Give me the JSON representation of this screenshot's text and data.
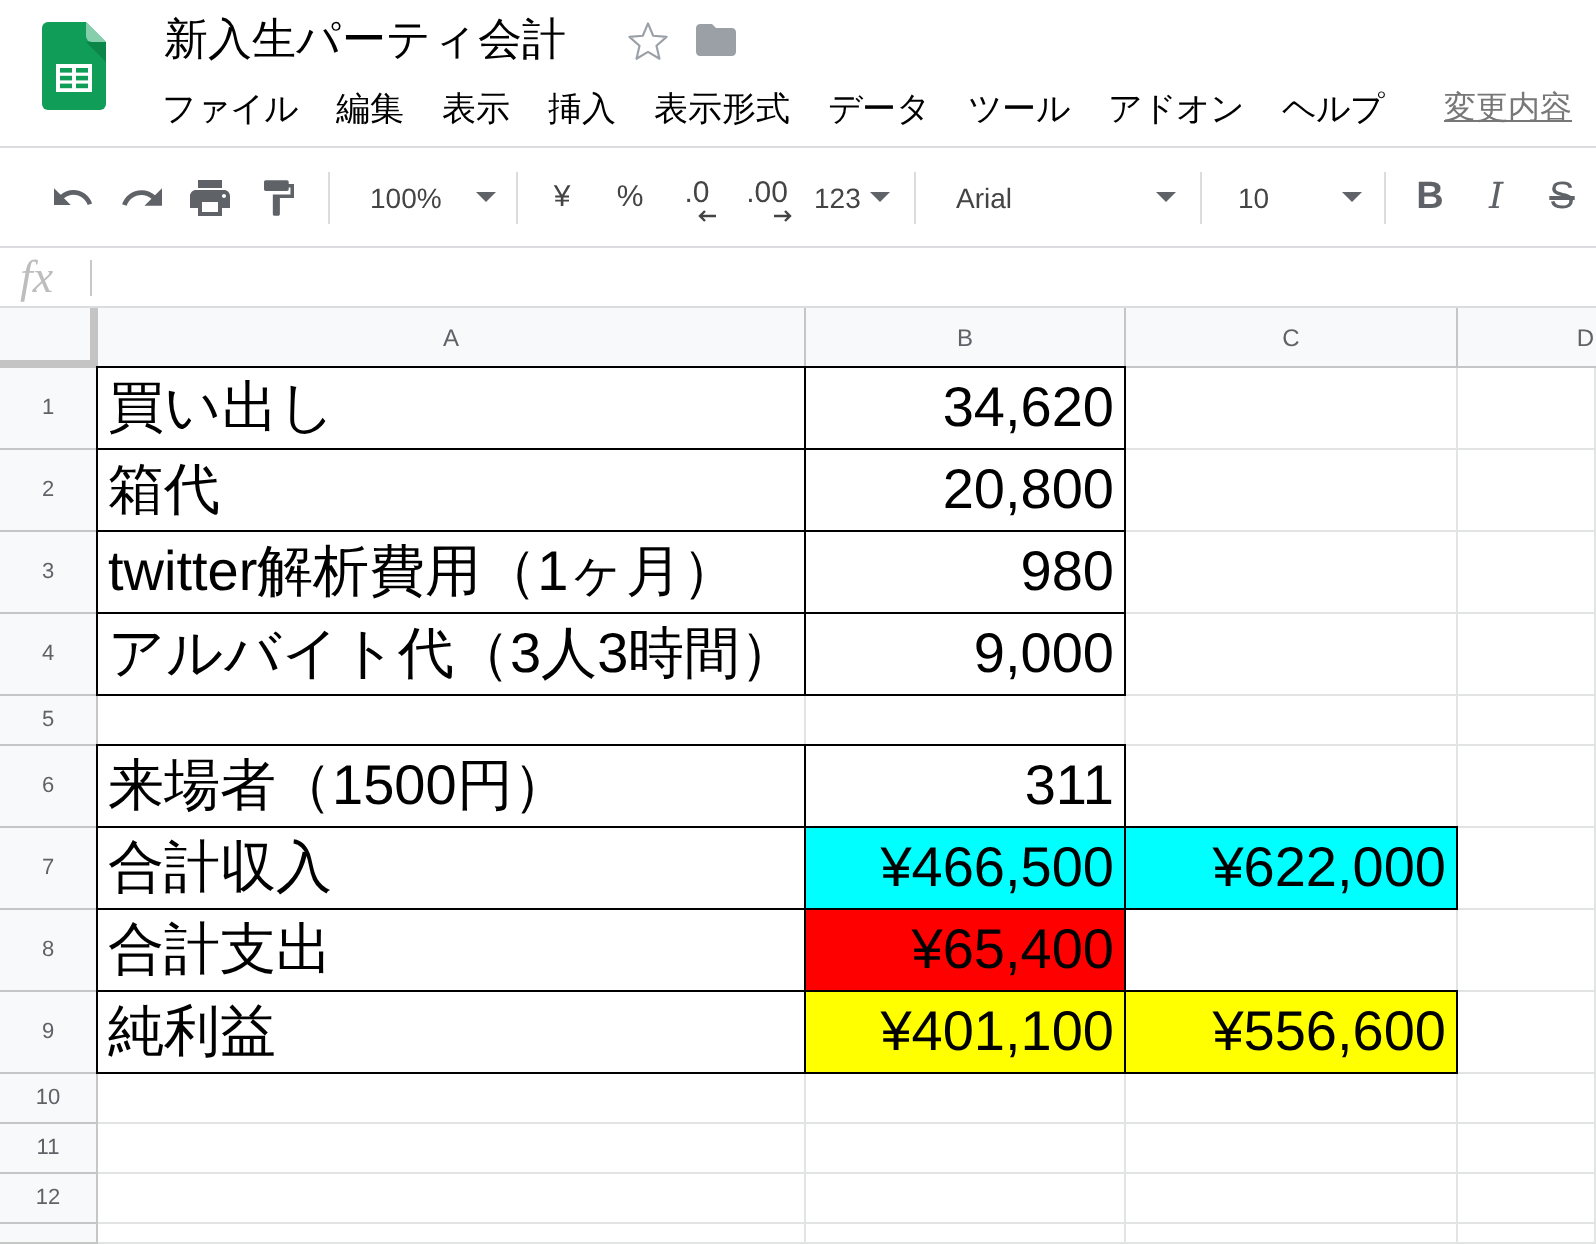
{
  "app": {
    "title": "新入生パーティ会計",
    "starred": false
  },
  "menu": [
    "ファイル",
    "編集",
    "表示",
    "挿入",
    "表示形式",
    "データ",
    "ツール",
    "アドオン",
    "ヘルプ"
  ],
  "save_status": "変更内容",
  "toolbar": {
    "zoom": "100%",
    "currency": "¥",
    "percent": "%",
    "decrease_decimal": ".0",
    "increase_decimal": ".00",
    "number_format": "123",
    "font": "Arial",
    "font_size": "10",
    "bold": "B",
    "italic": "I",
    "strikethrough": "S"
  },
  "formula_bar": {
    "label": "fx"
  },
  "sheet": {
    "columns": [
      "A",
      "B",
      "C",
      "D"
    ],
    "rows": [
      {
        "number": "1",
        "cells": [
          {
            "text": "買い出し",
            "bordered": true
          },
          {
            "text": "34,620",
            "bordered": true
          }
        ]
      },
      {
        "number": "2",
        "cells": [
          {
            "text": "箱代",
            "bordered": true
          },
          {
            "text": "20,800",
            "bordered": true
          }
        ]
      },
      {
        "number": "3",
        "cells": [
          {
            "text": "twitter解析費用（1ヶ月）",
            "bordered": true
          },
          {
            "text": "980",
            "bordered": true
          }
        ]
      },
      {
        "number": "4",
        "cells": [
          {
            "text": "アルバイト代（3人3時間）",
            "bordered": true
          },
          {
            "text": "9,000",
            "bordered": true
          }
        ]
      },
      {
        "number": "5"
      },
      {
        "number": "6",
        "cells": [
          {
            "text": "来場者（1500円）",
            "bordered": true
          },
          {
            "text": "311",
            "bordered": true
          }
        ]
      },
      {
        "number": "7",
        "cells": [
          {
            "text": "合計収入",
            "bordered": true
          },
          {
            "text": "¥466,500",
            "bordered": true,
            "color": "#00ffff"
          },
          {
            "text": "¥622,000",
            "bordered": true,
            "color": "#00ffff"
          }
        ]
      },
      {
        "number": "8",
        "cells": [
          {
            "text": "合計支出",
            "bordered": true
          },
          {
            "text": "¥65,400",
            "bordered": true,
            "color": "#ff0000"
          }
        ]
      },
      {
        "number": "9",
        "cells": [
          {
            "text": "純利益",
            "bordered": true
          },
          {
            "text": "¥401,100",
            "bordered": true,
            "color": "#ffff00"
          },
          {
            "text": "¥556,600",
            "bordered": true,
            "color": "#ffff00"
          }
        ]
      },
      {
        "number": "10"
      },
      {
        "number": "11"
      },
      {
        "number": "12"
      }
    ]
  }
}
